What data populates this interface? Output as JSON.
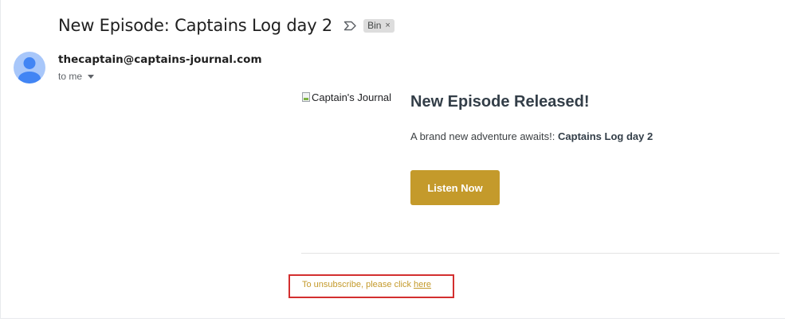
{
  "email": {
    "subject": "New Episode: Captains Log day 2",
    "importance_icon": "label-arrow-icon",
    "label": {
      "text": "Bin",
      "close": "×"
    },
    "sender": "thecaptain@captains-journal.com",
    "recipient": "to me",
    "avatar_icon": "person-icon"
  },
  "body": {
    "logo_alt": "Captain's Journal",
    "headline": "New Episode Released!",
    "description_prefix": "A brand new adventure awaits!: ",
    "description_title": "Captains Log day 2",
    "cta_label": "Listen Now",
    "unsubscribe_text": "To unsubscribe, please click ",
    "unsubscribe_link": "here"
  },
  "colors": {
    "accent": "#c49a2b",
    "headline": "#333e48",
    "highlight_box": "#d32f2f",
    "avatar_bg": "#a8c7fa",
    "avatar_fg": "#4285f4"
  }
}
